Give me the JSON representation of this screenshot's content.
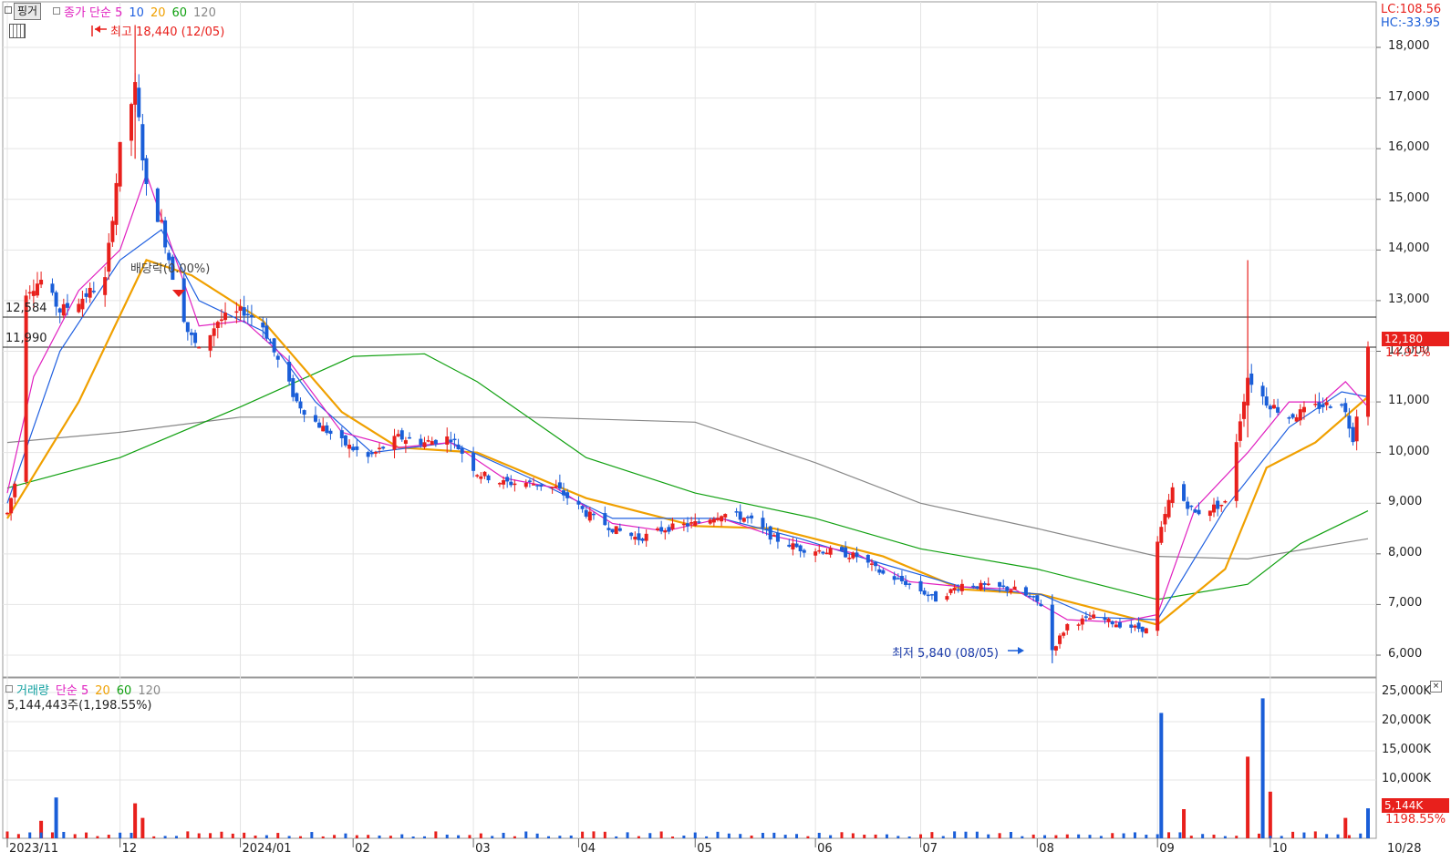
{
  "toolbar": {
    "pin_button": "핑거",
    "ma_legend": [
      {
        "label": "종가 단순 5",
        "color": "#e020c0"
      },
      {
        "label": "10",
        "color": "#2060e0"
      },
      {
        "label": "20",
        "color": "#f0a000"
      },
      {
        "label": "60",
        "color": "#10a010"
      },
      {
        "label": "120",
        "color": "#888888"
      }
    ]
  },
  "price_panel": {
    "lc_label": "LC:108.56",
    "hc_label": "HC:-33.95",
    "y_ticks": [
      "18,000",
      "17,000",
      "16,000",
      "15,000",
      "14,000",
      "13,000",
      "12,000",
      "11,000",
      "10,000",
      "9,000",
      "8,000",
      "7,000",
      "6,000"
    ],
    "hline_upper": "12,584",
    "hline_lower": "11,990",
    "current_price": "12,180",
    "current_change": "14.91%",
    "high_annotation": "최고 18,440 (12/05)",
    "low_annotation": "최저 5,840 (08/05)",
    "dividend_annotation": "배당락(0.00%)"
  },
  "volume_panel": {
    "legend": [
      {
        "label": "거래량",
        "color": "#10a0a0"
      },
      {
        "label": "단순 5",
        "color": "#e020c0"
      },
      {
        "label": "20",
        "color": "#f0a000"
      },
      {
        "label": "60",
        "color": "#10a010"
      },
      {
        "label": "120",
        "color": "#888888"
      }
    ],
    "volume_text": "5,144,443주(1,198.55%)",
    "y_ticks": [
      "25,000K",
      "20,000K",
      "15,000K",
      "10,000K"
    ],
    "current_volume": "5,144K",
    "current_volume_pct": "1198.55%"
  },
  "x_axis": {
    "labels": [
      "2023/11",
      "12",
      "2024/01",
      "02",
      "03",
      "04",
      "05",
      "06",
      "07",
      "08",
      "09",
      "10"
    ],
    "right_label": "10/28"
  },
  "colors": {
    "up": "#e8201c",
    "down": "#1a5ed8",
    "grid": "#e4e4e4",
    "ma5": "#e020c0",
    "ma10": "#2060e0",
    "ma20": "#f0a000",
    "ma60": "#10a010",
    "ma120": "#888888"
  },
  "chart_data": {
    "type": "candlestick",
    "x_range": [
      "2023-11-01",
      "2024-10-28"
    ],
    "price_range": [
      5500,
      18600
    ],
    "hlines": [
      12584,
      11990
    ],
    "price_path": [
      [
        "2023-11-01",
        8800
      ],
      [
        "2023-11-03",
        9400
      ],
      [
        "2023-11-06",
        13200
      ],
      [
        "2023-11-10",
        13400
      ],
      [
        "2023-11-15",
        12800
      ],
      [
        "2023-11-20",
        13000
      ],
      [
        "2023-11-27",
        13400
      ],
      [
        "2023-12-01",
        16000
      ],
      [
        "2023-12-05",
        17200
      ],
      [
        "2023-12-08",
        15200
      ],
      [
        "2023-12-12",
        14500
      ],
      [
        "2023-12-15",
        13500
      ],
      [
        "2023-12-19",
        12400
      ],
      [
        "2023-12-22",
        12000
      ],
      [
        "2023-12-27",
        12600
      ],
      [
        "2024-01-03",
        12800
      ],
      [
        "2024-01-08",
        12500
      ],
      [
        "2024-01-12",
        11800
      ],
      [
        "2024-01-17",
        11000
      ],
      [
        "2024-01-22",
        10600
      ],
      [
        "2024-01-29",
        10200
      ],
      [
        "2024-02-05",
        9900
      ],
      [
        "2024-02-13",
        10300
      ],
      [
        "2024-02-20",
        10200
      ],
      [
        "2024-02-27",
        10300
      ],
      [
        "2024-03-05",
        9600
      ],
      [
        "2024-03-12",
        9400
      ],
      [
        "2024-03-19",
        9400
      ],
      [
        "2024-03-26",
        9300
      ],
      [
        "2024-04-03",
        8800
      ],
      [
        "2024-04-10",
        8500
      ],
      [
        "2024-04-17",
        8300
      ],
      [
        "2024-04-24",
        8500
      ],
      [
        "2024-05-02",
        8600
      ],
      [
        "2024-05-09",
        8800
      ],
      [
        "2024-05-16",
        8700
      ],
      [
        "2024-05-23",
        8300
      ],
      [
        "2024-05-30",
        8100
      ],
      [
        "2024-06-07",
        8050
      ],
      [
        "2024-06-14",
        7950
      ],
      [
        "2024-06-21",
        7600
      ],
      [
        "2024-06-28",
        7400
      ],
      [
        "2024-07-05",
        7100
      ],
      [
        "2024-07-12",
        7400
      ],
      [
        "2024-07-19",
        7350
      ],
      [
        "2024-07-26",
        7300
      ],
      [
        "2024-08-02",
        7000
      ],
      [
        "2024-08-05",
        6100
      ],
      [
        "2024-08-09",
        6600
      ],
      [
        "2024-08-16",
        6750
      ],
      [
        "2024-08-23",
        6600
      ],
      [
        "2024-08-30",
        6500
      ],
      [
        "2024-09-02",
        8200
      ],
      [
        "2024-09-06",
        9300
      ],
      [
        "2024-09-12",
        8800
      ],
      [
        "2024-09-20",
        9000
      ],
      [
        "2024-09-26",
        11500
      ],
      [
        "2024-10-01",
        11000
      ],
      [
        "2024-10-07",
        10700
      ],
      [
        "2024-10-14",
        10900
      ],
      [
        "2024-10-21",
        11000
      ],
      [
        "2024-10-24",
        10300
      ],
      [
        "2024-10-28",
        12180
      ]
    ],
    "ma5": [
      [
        "2023-11-01",
        9200
      ],
      [
        "2023-11-08",
        11500
      ],
      [
        "2023-11-20",
        13200
      ],
      [
        "2023-12-01",
        14000
      ],
      [
        "2023-12-08",
        15500
      ],
      [
        "2023-12-15",
        14000
      ],
      [
        "2023-12-22",
        12500
      ],
      [
        "2024-01-03",
        12600
      ],
      [
        "2024-01-15",
        11800
      ],
      [
        "2024-01-29",
        10400
      ],
      [
        "2024-02-13",
        10100
      ],
      [
        "2024-02-27",
        10200
      ],
      [
        "2024-03-12",
        9500
      ],
      [
        "2024-03-26",
        9300
      ],
      [
        "2024-04-10",
        8600
      ],
      [
        "2024-04-24",
        8450
      ],
      [
        "2024-05-09",
        8700
      ],
      [
        "2024-05-23",
        8350
      ],
      [
        "2024-06-14",
        8000
      ],
      [
        "2024-06-28",
        7450
      ],
      [
        "2024-07-12",
        7350
      ],
      [
        "2024-07-26",
        7300
      ],
      [
        "2024-08-09",
        6700
      ],
      [
        "2024-08-23",
        6650
      ],
      [
        "2024-09-02",
        6800
      ],
      [
        "2024-09-12",
        8900
      ],
      [
        "2024-09-26",
        10000
      ],
      [
        "2024-10-07",
        11000
      ],
      [
        "2024-10-16",
        11000
      ],
      [
        "2024-10-22",
        11400
      ],
      [
        "2024-10-28",
        10900
      ]
    ],
    "ma10": [
      [
        "2023-11-01",
        9000
      ],
      [
        "2023-11-15",
        12000
      ],
      [
        "2023-12-01",
        13800
      ],
      [
        "2023-12-12",
        14400
      ],
      [
        "2023-12-22",
        13000
      ],
      [
        "2024-01-08",
        12400
      ],
      [
        "2024-01-22",
        11000
      ],
      [
        "2024-02-06",
        10000
      ],
      [
        "2024-02-27",
        10200
      ],
      [
        "2024-03-19",
        9500
      ],
      [
        "2024-04-10",
        8700
      ],
      [
        "2024-05-09",
        8700
      ],
      [
        "2024-05-30",
        8300
      ],
      [
        "2024-06-21",
        7800
      ],
      [
        "2024-07-12",
        7350
      ],
      [
        "2024-08-02",
        7200
      ],
      [
        "2024-08-16",
        6750
      ],
      [
        "2024-09-02",
        6700
      ],
      [
        "2024-09-20",
        8900
      ],
      [
        "2024-10-07",
        10500
      ],
      [
        "2024-10-21",
        11200
      ],
      [
        "2024-10-28",
        11100
      ]
    ],
    "ma20": [
      [
        "2023-11-01",
        8700
      ],
      [
        "2023-11-20",
        11000
      ],
      [
        "2023-12-08",
        13800
      ],
      [
        "2023-12-20",
        13500
      ],
      [
        "2024-01-08",
        12600
      ],
      [
        "2024-01-29",
        10800
      ],
      [
        "2024-02-13",
        10100
      ],
      [
        "2024-03-05",
        10000
      ],
      [
        "2024-04-03",
        9100
      ],
      [
        "2024-05-02",
        8550
      ],
      [
        "2024-05-23",
        8500
      ],
      [
        "2024-06-21",
        7950
      ],
      [
        "2024-07-12",
        7300
      ],
      [
        "2024-08-02",
        7200
      ],
      [
        "2024-09-02",
        6600
      ],
      [
        "2024-09-20",
        7700
      ],
      [
        "2024-10-01",
        9700
      ],
      [
        "2024-10-14",
        10200
      ],
      [
        "2024-10-28",
        11100
      ]
    ],
    "ma60": [
      [
        "2023-11-01",
        9300
      ],
      [
        "2023-12-01",
        9900
      ],
      [
        "2024-01-02",
        10900
      ],
      [
        "2024-02-01",
        11900
      ],
      [
        "2024-02-20",
        11950
      ],
      [
        "2024-03-05",
        11400
      ],
      [
        "2024-04-03",
        9900
      ],
      [
        "2024-05-02",
        9200
      ],
      [
        "2024-06-03",
        8700
      ],
      [
        "2024-07-01",
        8100
      ],
      [
        "2024-08-01",
        7700
      ],
      [
        "2024-09-02",
        7100
      ],
      [
        "2024-09-26",
        7400
      ],
      [
        "2024-10-10",
        8200
      ],
      [
        "2024-10-28",
        8850
      ]
    ],
    "ma120": [
      [
        "2023-11-01",
        10200
      ],
      [
        "2023-12-01",
        10400
      ],
      [
        "2024-01-02",
        10700
      ],
      [
        "2024-02-13",
        10700
      ],
      [
        "2024-03-19",
        10700
      ],
      [
        "2024-05-02",
        10600
      ],
      [
        "2024-06-03",
        9800
      ],
      [
        "2024-07-01",
        9000
      ],
      [
        "2024-08-01",
        8500
      ],
      [
        "2024-09-02",
        7950
      ],
      [
        "2024-09-26",
        7900
      ],
      [
        "2024-10-28",
        8300
      ]
    ],
    "volume_k": [
      [
        "2023-11-10",
        3000
      ],
      [
        "2023-11-14",
        7000
      ],
      [
        "2023-12-05",
        6000
      ],
      [
        "2023-12-07",
        3500
      ],
      [
        "2024-09-03",
        21500
      ],
      [
        "2024-09-09",
        5000
      ],
      [
        "2024-09-26",
        14000
      ],
      [
        "2024-09-30",
        24000
      ],
      [
        "2024-10-02",
        8000
      ],
      [
        "2024-10-22",
        3500
      ],
      [
        "2024-10-28",
        5144
      ]
    ]
  }
}
